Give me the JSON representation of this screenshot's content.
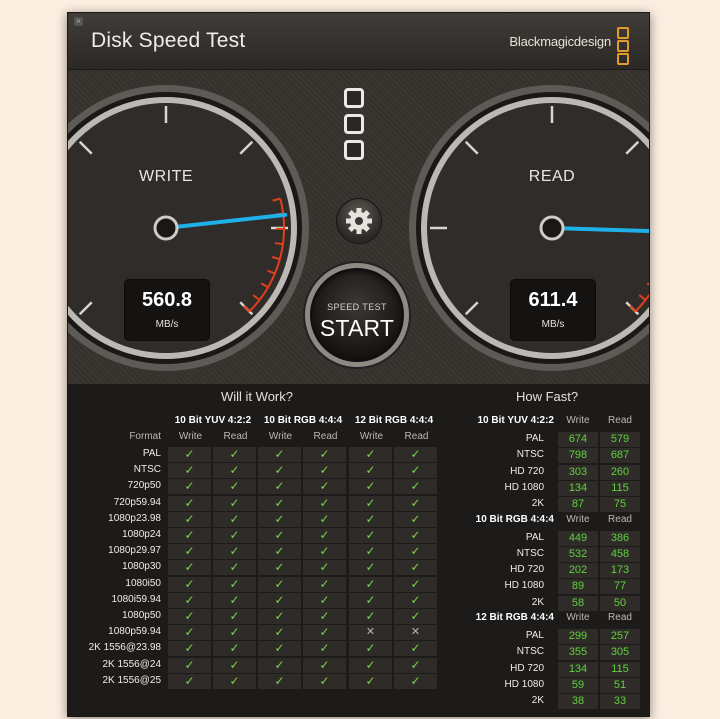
{
  "window": {
    "title": "Disk Speed Test",
    "brand": "Blackmagicdesign",
    "close_glyph": "×"
  },
  "gauges": {
    "write": {
      "label": "WRITE",
      "value": "560.8",
      "unit": "MB/s",
      "needle_fraction": 0.81
    },
    "read": {
      "label": "READ",
      "value": "611.4",
      "unit": "MB/s",
      "needle_fraction": 0.84
    }
  },
  "controls": {
    "settings_icon": "gear-icon",
    "start_small": "SPEED TEST",
    "start_big": "START"
  },
  "colors": {
    "needle": "#1fb0e8",
    "redline": "#e0401c",
    "check": "#7bd44b",
    "speed_value": "#5fd23d",
    "brand_logo": "#e19a2c"
  },
  "will_it_work": {
    "title": "Will it Work?",
    "format_header": "Format",
    "groups": [
      "10 Bit YUV 4:2:2",
      "10 Bit RGB 4:4:4",
      "12 Bit RGB 4:4:4"
    ],
    "sub": [
      "Write",
      "Read"
    ],
    "check_glyph": "✓",
    "cross_glyph": "✕",
    "rows": [
      {
        "format": "PAL",
        "status": [
          1,
          1,
          1,
          1,
          1,
          1
        ]
      },
      {
        "format": "NTSC",
        "status": [
          1,
          1,
          1,
          1,
          1,
          1
        ]
      },
      {
        "format": "720p50",
        "status": [
          1,
          1,
          1,
          1,
          1,
          1
        ]
      },
      {
        "format": "720p59.94",
        "status": [
          1,
          1,
          1,
          1,
          1,
          1
        ]
      },
      {
        "format": "1080p23.98",
        "status": [
          1,
          1,
          1,
          1,
          1,
          1
        ]
      },
      {
        "format": "1080p24",
        "status": [
          1,
          1,
          1,
          1,
          1,
          1
        ]
      },
      {
        "format": "1080p29.97",
        "status": [
          1,
          1,
          1,
          1,
          1,
          1
        ]
      },
      {
        "format": "1080p30",
        "status": [
          1,
          1,
          1,
          1,
          1,
          1
        ]
      },
      {
        "format": "1080i50",
        "status": [
          1,
          1,
          1,
          1,
          1,
          1
        ]
      },
      {
        "format": "1080i59.94",
        "status": [
          1,
          1,
          1,
          1,
          1,
          1
        ]
      },
      {
        "format": "1080p50",
        "status": [
          1,
          1,
          1,
          1,
          1,
          1
        ]
      },
      {
        "format": "1080p59.94",
        "status": [
          1,
          1,
          1,
          1,
          0,
          0
        ]
      },
      {
        "format": "2K 1556@23.98",
        "status": [
          1,
          1,
          1,
          1,
          1,
          1
        ]
      },
      {
        "format": "2K 1556@24",
        "status": [
          1,
          1,
          1,
          1,
          1,
          1
        ]
      },
      {
        "format": "2K 1556@25",
        "status": [
          1,
          1,
          1,
          1,
          1,
          1
        ]
      }
    ]
  },
  "how_fast": {
    "title": "How Fast?",
    "sub": [
      "Write",
      "Read"
    ],
    "groups": [
      {
        "name": "10 Bit YUV 4:2:2",
        "rows": [
          {
            "format": "PAL",
            "write": "674",
            "read": "579"
          },
          {
            "format": "NTSC",
            "write": "798",
            "read": "687"
          },
          {
            "format": "HD 720",
            "write": "303",
            "read": "260"
          },
          {
            "format": "HD 1080",
            "write": "134",
            "read": "115"
          },
          {
            "format": "2K",
            "write": "87",
            "read": "75"
          }
        ]
      },
      {
        "name": "10 Bit RGB 4:4:4",
        "rows": [
          {
            "format": "PAL",
            "write": "449",
            "read": "386"
          },
          {
            "format": "NTSC",
            "write": "532",
            "read": "458"
          },
          {
            "format": "HD 720",
            "write": "202",
            "read": "173"
          },
          {
            "format": "HD 1080",
            "write": "89",
            "read": "77"
          },
          {
            "format": "2K",
            "write": "58",
            "read": "50"
          }
        ]
      },
      {
        "name": "12 Bit RGB 4:4:4",
        "rows": [
          {
            "format": "PAL",
            "write": "299",
            "read": "257"
          },
          {
            "format": "NTSC",
            "write": "355",
            "read": "305"
          },
          {
            "format": "HD 720",
            "write": "134",
            "read": "115"
          },
          {
            "format": "HD 1080",
            "write": "59",
            "read": "51"
          },
          {
            "format": "2K",
            "write": "38",
            "read": "33"
          }
        ]
      }
    ]
  }
}
